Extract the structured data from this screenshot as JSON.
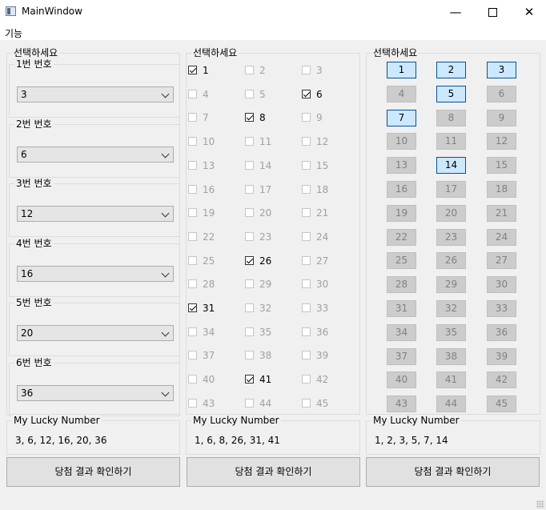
{
  "window": {
    "title": "MainWindow",
    "min_glyph": "—",
    "close_glyph": "✕"
  },
  "menu": {
    "items": [
      "기능"
    ]
  },
  "panel1": {
    "title": "선택하세요",
    "groups": [
      {
        "label": "1번 번호",
        "value": "3"
      },
      {
        "label": "2번 번호",
        "value": "6"
      },
      {
        "label": "3번 번호",
        "value": "12"
      },
      {
        "label": "4번 번호",
        "value": "16"
      },
      {
        "label": "5번 번호",
        "value": "20"
      },
      {
        "label": "6번 번호",
        "value": "36"
      }
    ]
  },
  "panel2": {
    "title": "선택하세요",
    "checked": [
      1,
      6,
      8,
      26,
      31,
      41
    ]
  },
  "panel3": {
    "title": "선택하세요",
    "selected": [
      1,
      2,
      3,
      5,
      7,
      14
    ]
  },
  "lucky": [
    {
      "title": "My Lucky Number",
      "value": "3, 6, 12, 16, 20, 36",
      "button": "당첨 결과 확인하기"
    },
    {
      "title": "My Lucky Number",
      "value": "1, 6, 8, 26, 31, 41",
      "button": "당첨 결과 확인하기"
    },
    {
      "title": "My Lucky Number",
      "value": "1, 2, 3, 5, 7, 14",
      "button": "당첨 결과 확인하기"
    }
  ]
}
